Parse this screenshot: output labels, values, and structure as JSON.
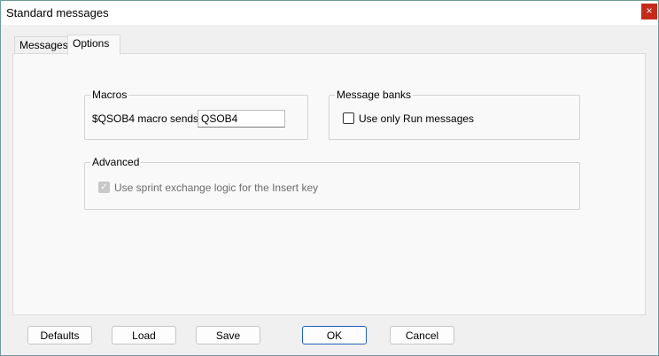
{
  "window": {
    "title": "Standard messages",
    "close_glyph": "×"
  },
  "tabs": [
    {
      "label": "Messages",
      "active": false
    },
    {
      "label": "Options",
      "active": true
    }
  ],
  "macros": {
    "group_label": "Macros",
    "qsob4_label": "$QSOB4 macro sends:",
    "qsob4_value": "QSOB4"
  },
  "message_banks": {
    "group_label": "Message banks",
    "use_only_run_label": "Use only Run messages",
    "use_only_run_checked": false
  },
  "advanced": {
    "group_label": "Advanced",
    "sprint_label": "Use sprint exchange logic for the Insert key",
    "sprint_checked": true,
    "sprint_check_glyph": "✓"
  },
  "buttons": {
    "defaults": "Defaults",
    "load": "Load",
    "save": "Save",
    "ok": "OK",
    "cancel": "Cancel"
  },
  "colors": {
    "close_button": "#c42b1c",
    "default_button_border": "#1e5fbf"
  }
}
